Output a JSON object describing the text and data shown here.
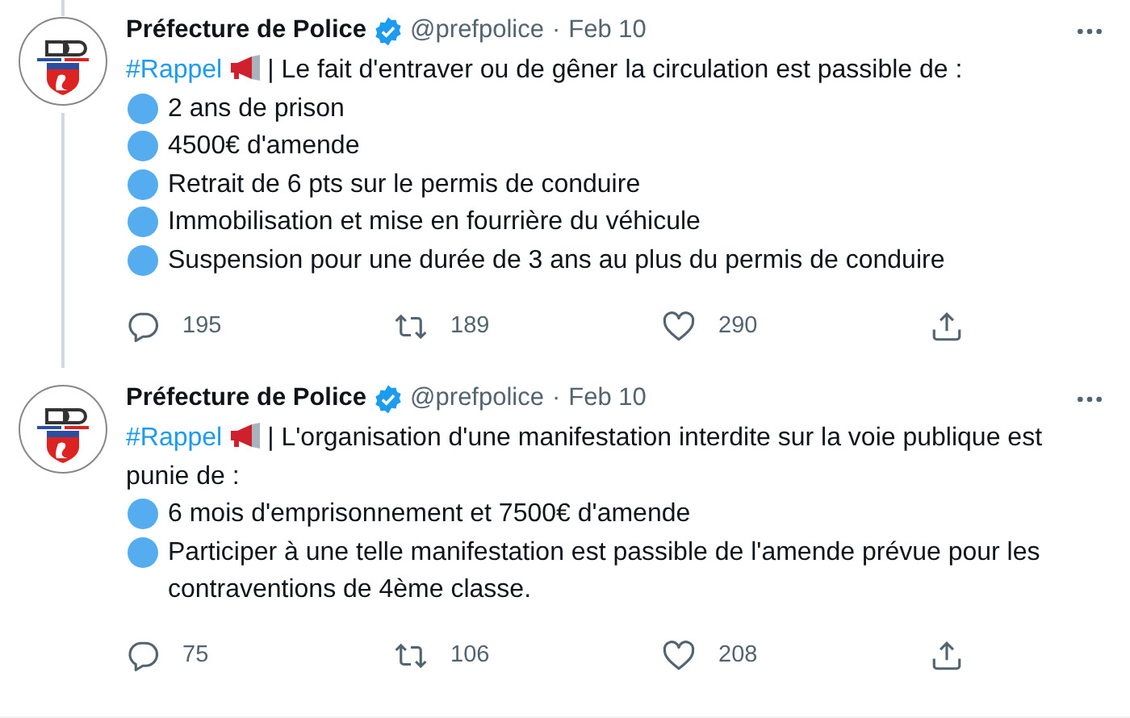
{
  "tweets": [
    {
      "author": "Préfecture de Police",
      "handle": "@prefpolice",
      "separator": "·",
      "date": "Feb 10",
      "thread_above": true,
      "thread_below": true,
      "hashtag": "#Rappel",
      "intro": "| Le fait d'entraver ou de gêner la circulation est passible de :",
      "bullets": [
        "2 ans de prison",
        "4500€ d'amende",
        "Retrait de 6 pts sur le permis de conduire",
        "Immobilisation et mise en fourrière du véhicule",
        "Suspension pour une durée de 3 ans au plus du permis de conduire"
      ],
      "replies": "195",
      "retweets": "189",
      "likes": "290"
    },
    {
      "author": "Préfecture de Police",
      "handle": "@prefpolice",
      "separator": "·",
      "date": "Feb 10",
      "thread_above": false,
      "thread_below": false,
      "hashtag": "#Rappel",
      "intro": "| L'organisation d'une manifestation interdite sur la voie publique est punie de :",
      "bullets": [
        "6 mois d'emprisonnement et 7500€ d'amende",
        "Participer à une telle manifestation est passible de l'amende prévue pour les contraventions de 4ème classe."
      ],
      "replies": "75",
      "retweets": "106",
      "likes": "208"
    }
  ]
}
